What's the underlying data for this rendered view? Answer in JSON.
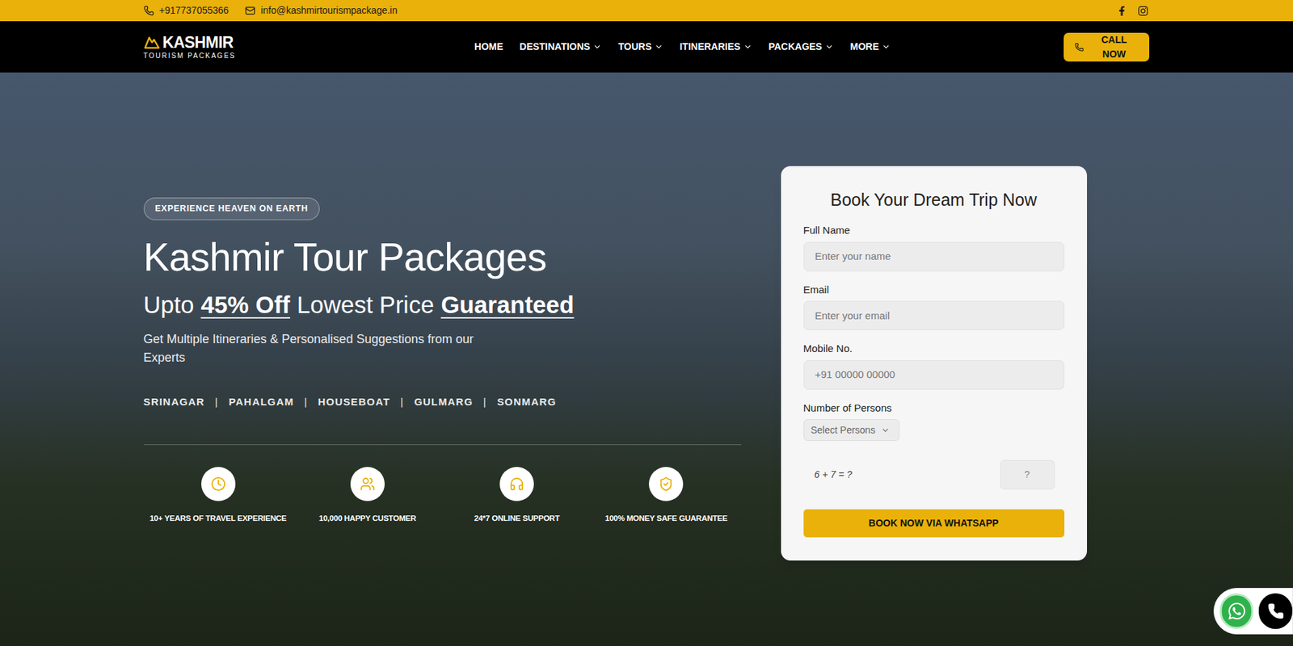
{
  "top_bar": {
    "phone": "+917737055366",
    "email": "info@kashmirtourismpackage.in",
    "social": [
      "facebook",
      "instagram"
    ]
  },
  "nav": {
    "logo": {
      "title": "KASHMIR",
      "subtitle": "TOURISM PACKAGES"
    },
    "items": [
      {
        "label": "HOME",
        "dropdown": false
      },
      {
        "label": "DESTINATIONS",
        "dropdown": true
      },
      {
        "label": "TOURS",
        "dropdown": true
      },
      {
        "label": "ITINERARIES",
        "dropdown": true
      },
      {
        "label": "PACKAGES",
        "dropdown": true
      },
      {
        "label": "MORE",
        "dropdown": true
      }
    ],
    "call_button": "CALL NOW"
  },
  "hero": {
    "badge": "EXPERIENCE HEAVEN ON EARTH",
    "title": "Kashmir Tour Packages",
    "subtitle": [
      {
        "text": "Upto",
        "emphasis": false
      },
      {
        "text": "45% Off",
        "emphasis": true
      },
      {
        "text": "Lowest Price",
        "emphasis": false
      },
      {
        "text": "Guaranteed",
        "emphasis": true
      }
    ],
    "description": "Get Multiple Itineraries & Personalised Suggestions from our Experts",
    "places": [
      "SRINAGAR",
      "PAHALGAM",
      "HOUSEBOAT",
      "GULMARG",
      "SONMARG"
    ],
    "separator": "|",
    "features": [
      {
        "icon": "clock",
        "label": "10+ YEARS OF TRAVEL EXPERIENCE"
      },
      {
        "icon": "users",
        "label": "10,000 HAPPY CUSTOMER"
      },
      {
        "icon": "headphones",
        "label": "24*7 ONLINE SUPPORT"
      },
      {
        "icon": "shield",
        "label": "100% MONEY SAFE GUARANTEE"
      }
    ]
  },
  "form": {
    "title": "Book Your Dream Trip Now",
    "fields": [
      {
        "label": "Full Name",
        "placeholder": "Enter your name"
      },
      {
        "label": "Email",
        "placeholder": "Enter your email"
      },
      {
        "label": "Mobile No.",
        "placeholder": "+91 00000 00000"
      }
    ],
    "persons": {
      "label": "Number of Persons",
      "placeholder": "Select Persons"
    },
    "captcha": {
      "question": "6 + 7 = ?",
      "placeholder": "?"
    },
    "submit": "BOOK NOW VIA WHATSAPP"
  },
  "floating": [
    "whatsapp",
    "phone"
  ]
}
